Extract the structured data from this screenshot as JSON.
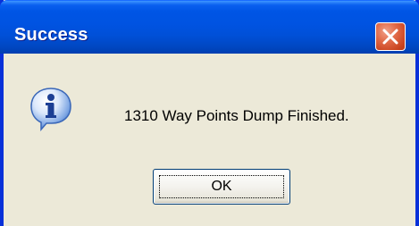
{
  "window": {
    "title": "Success"
  },
  "dialog": {
    "message": "1310 Way Points Dump Finished.",
    "icon": "information-icon",
    "ok_label": "OK"
  },
  "colors": {
    "titlebar": "#0055e5",
    "frame": "#0831d9",
    "dialog_bg": "#ece9d8",
    "close_button": "#e16a48"
  }
}
